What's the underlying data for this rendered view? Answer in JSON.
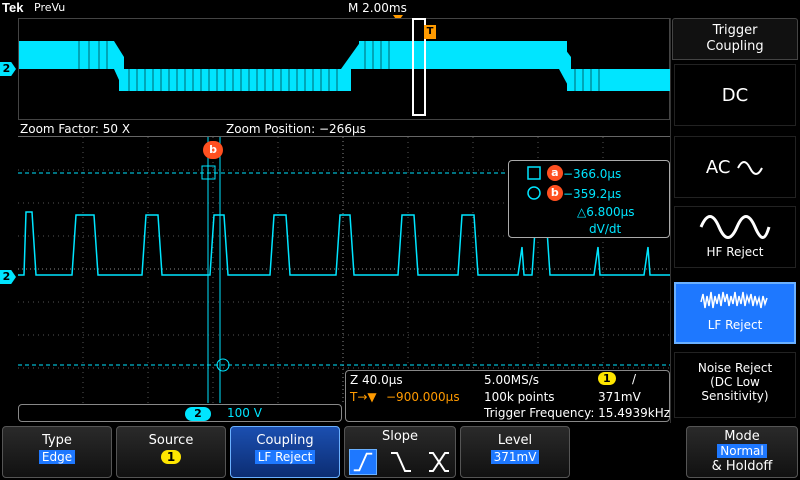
{
  "top": {
    "brand": "Tek",
    "status": "PreVu",
    "timebase": "M 2.00ms",
    "trigger_marker": "T"
  },
  "zoom": {
    "factor": "Zoom Factor: 50 X",
    "position": "Zoom Position: −266µs"
  },
  "channel_label": "2",
  "cursor": {
    "a_label": "a",
    "a_value": "−366.0µs",
    "b_label": "b",
    "b_value": "−359.2µs",
    "delta": "△6.800µs",
    "unit": "dV/dt",
    "b_marker": "b"
  },
  "ch_readout": {
    "channel": "2",
    "scale": "100 V"
  },
  "acq": {
    "zoom_time": "Z 40.0µs",
    "sample_rate": "5.00MS/s",
    "trig_channel": "1",
    "slope_glyph": "/",
    "trig_pos_prefix": "T→▼",
    "trig_pos": "−900.000µs",
    "record": "100k points",
    "level": "371mV",
    "trig_freq": "Trigger Frequency: 15.4939kHz"
  },
  "side_menu": {
    "title_line1": "Trigger",
    "title_line2": "Coupling",
    "dc": "DC",
    "ac": "AC",
    "hf_reject": "HF Reject",
    "lf_reject": "LF Reject",
    "noise_line1": "Noise Reject",
    "noise_line2": "(DC Low",
    "noise_line3": "Sensitivity)"
  },
  "bottom_menu": {
    "type_label": "Type",
    "type_value": "Edge",
    "source_label": "Source",
    "source_value": "1",
    "coupling_label": "Coupling",
    "coupling_value": "LF Reject",
    "slope_label": "Slope",
    "level_label": "Level",
    "level_value": "371mV",
    "mode_line1": "Mode",
    "mode_value": "Normal",
    "mode_line3": "& Holdoff"
  },
  "colors": {
    "trace": "#00e5ff",
    "trigger": "#ff9a00",
    "cursor_marker": "#ff5020",
    "selection": "#1e78ff",
    "source_badge": "#ffe600"
  }
}
